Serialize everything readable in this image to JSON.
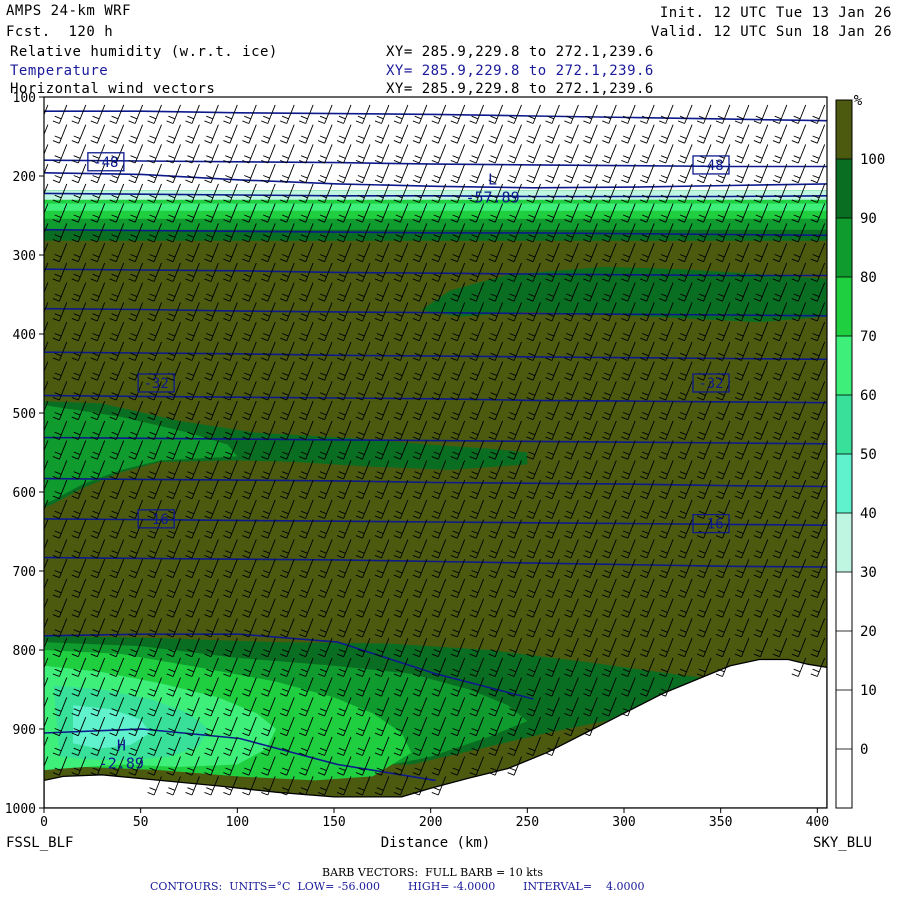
{
  "header": {
    "model": "AMPS 24-km WRF",
    "fcst": "Fcst.  120 h",
    "init": "Init. 12 UTC Tue 13 Jan 26",
    "valid": "Valid. 12 UTC Sun 18 Jan 26",
    "fields": [
      {
        "name": "Relative humidity (w.r.t. ice)",
        "xy": "XY= 285.9,229.8 to 272.1,239.6"
      },
      {
        "name": "Temperature",
        "xy": "XY= 285.9,229.8 to 272.1,239.6"
      },
      {
        "name": "Horizontal wind vectors",
        "xy": "XY= 285.9,229.8 to 272.1,239.6"
      }
    ]
  },
  "footer": {
    "barb": "BARB VECTORS:  FULL BARB = 10 kts",
    "contours": "CONTOURS:  UNITS=°C  LOW= -56.000        HIGH= -4.0000        INTERVAL=    4.0000"
  },
  "chart_data": {
    "type": "cross-section",
    "xlabel": "Distance (km)",
    "xlim": [
      0,
      405
    ],
    "ylim": [
      1000,
      100
    ],
    "x_ticks": [
      0,
      50,
      100,
      150,
      200,
      250,
      300,
      350,
      400
    ],
    "y_ticks": [
      100,
      200,
      300,
      400,
      500,
      600,
      700,
      800,
      900,
      1000
    ],
    "start_label": "FSSL_BLF",
    "end_label": "SKY_BLU",
    "colorbar": {
      "unit": "%",
      "levels": [
        0,
        10,
        20,
        30,
        40,
        50,
        60,
        70,
        80,
        90,
        100
      ],
      "colors": [
        "#ffffff",
        "#ffffff",
        "#ffffff",
        "#ffffff",
        "#bff6e2",
        "#5ff2cc",
        "#38e09a",
        "#3ef07a",
        "#1fcf40",
        "#0f9b2e",
        "#0a6e22",
        "#4c5a10"
      ]
    },
    "terrain_profile": [
      [
        0,
        1000
      ],
      [
        0,
        965
      ],
      [
        10,
        960
      ],
      [
        30,
        958
      ],
      [
        60,
        965
      ],
      [
        90,
        972
      ],
      [
        120,
        980
      ],
      [
        150,
        986
      ],
      [
        185,
        986
      ],
      [
        200,
        975
      ],
      [
        220,
        962
      ],
      [
        240,
        950
      ],
      [
        260,
        930
      ],
      [
        280,
        905
      ],
      [
        300,
        880
      ],
      [
        320,
        855
      ],
      [
        340,
        835
      ],
      [
        355,
        820
      ],
      [
        370,
        812
      ],
      [
        385,
        812
      ],
      [
        395,
        818
      ],
      [
        405,
        822
      ],
      [
        405,
        1000
      ]
    ],
    "rh_regions": [
      {
        "level": 100,
        "polygon": [
          [
            0,
            218
          ],
          [
            405,
            218
          ],
          [
            405,
            1000
          ],
          [
            0,
            1000
          ]
        ]
      },
      {
        "level": 90,
        "polygon": [
          [
            0,
            218
          ],
          [
            405,
            218
          ],
          [
            405,
            282
          ],
          [
            0,
            282
          ]
        ]
      },
      {
        "level": 90,
        "polygon": [
          [
            195,
            370
          ],
          [
            210,
            345
          ],
          [
            240,
            325
          ],
          [
            290,
            315
          ],
          [
            330,
            318
          ],
          [
            375,
            325
          ],
          [
            405,
            330
          ],
          [
            405,
            378
          ],
          [
            370,
            385
          ],
          [
            330,
            380
          ],
          [
            290,
            375
          ],
          [
            250,
            372
          ],
          [
            215,
            378
          ]
        ]
      },
      {
        "level": 80,
        "polygon": [
          [
            0,
            218
          ],
          [
            405,
            218
          ],
          [
            405,
            268
          ],
          [
            0,
            268
          ]
        ]
      },
      {
        "level": 90,
        "polygon": [
          [
            0,
            485
          ],
          [
            30,
            488
          ],
          [
            70,
            510
          ],
          [
            110,
            525
          ],
          [
            160,
            532
          ],
          [
            200,
            540
          ],
          [
            230,
            545
          ],
          [
            250,
            550
          ],
          [
            250,
            565
          ],
          [
            210,
            572
          ],
          [
            170,
            568
          ],
          [
            130,
            562
          ],
          [
            100,
            560
          ],
          [
            60,
            562
          ],
          [
            40,
            575
          ],
          [
            20,
            595
          ],
          [
            5,
            615
          ],
          [
            0,
            620
          ]
        ]
      },
      {
        "level": 80,
        "polygon": [
          [
            0,
            490
          ],
          [
            40,
            505
          ],
          [
            75,
            525
          ],
          [
            95,
            540
          ],
          [
            100,
            555
          ],
          [
            60,
            560
          ],
          [
            40,
            572
          ],
          [
            20,
            590
          ],
          [
            5,
            610
          ],
          [
            0,
            615
          ]
        ]
      },
      {
        "level": 70,
        "polygon": [
          [
            0,
            218
          ],
          [
            405,
            218
          ],
          [
            405,
            254
          ],
          [
            0,
            254
          ]
        ]
      },
      {
        "level": 90,
        "polygon": [
          [
            0,
            782
          ],
          [
            60,
            785
          ],
          [
            120,
            790
          ],
          [
            180,
            792
          ],
          [
            230,
            800
          ],
          [
            280,
            815
          ],
          [
            330,
            832
          ],
          [
            360,
            840
          ],
          [
            340,
            856
          ],
          [
            310,
            880
          ],
          [
            260,
            905
          ],
          [
            220,
            928
          ],
          [
            190,
            945
          ],
          [
            150,
            945
          ],
          [
            100,
            938
          ],
          [
            60,
            930
          ],
          [
            20,
            928
          ],
          [
            0,
            930
          ]
        ]
      },
      {
        "level": 80,
        "polygon": [
          [
            0,
            790
          ],
          [
            50,
            795
          ],
          [
            100,
            810
          ],
          [
            150,
            820
          ],
          [
            190,
            830
          ],
          [
            220,
            850
          ],
          [
            240,
            870
          ],
          [
            250,
            890
          ],
          [
            230,
            910
          ],
          [
            200,
            935
          ],
          [
            170,
            950
          ],
          [
            130,
            955
          ],
          [
            90,
            950
          ],
          [
            50,
            942
          ],
          [
            10,
            942
          ],
          [
            0,
            945
          ]
        ]
      },
      {
        "level": 70,
        "polygon": [
          [
            0,
            800
          ],
          [
            40,
            805
          ],
          [
            80,
            822
          ],
          [
            120,
            840
          ],
          [
            150,
            860
          ],
          [
            170,
            880
          ],
          [
            185,
            905
          ],
          [
            190,
            930
          ],
          [
            170,
            960
          ],
          [
            140,
            965
          ],
          [
            100,
            960
          ],
          [
            60,
            952
          ],
          [
            20,
            948
          ],
          [
            0,
            950
          ]
        ]
      },
      {
        "level": 60,
        "polygon": [
          [
            0,
            235
          ],
          [
            405,
            235
          ],
          [
            405,
            244
          ],
          [
            0,
            244
          ]
        ]
      },
      {
        "level": 60,
        "polygon": [
          [
            0,
            820
          ],
          [
            30,
            828
          ],
          [
            60,
            842
          ],
          [
            90,
            860
          ],
          [
            110,
            880
          ],
          [
            120,
            900
          ],
          [
            115,
            925
          ],
          [
            100,
            945
          ],
          [
            70,
            948
          ],
          [
            40,
            945
          ],
          [
            10,
            950
          ],
          [
            0,
            952
          ]
        ]
      },
      {
        "level": 50,
        "polygon": [
          [
            5,
            845
          ],
          [
            30,
            850
          ],
          [
            55,
            862
          ],
          [
            75,
            880
          ],
          [
            85,
            900
          ],
          [
            80,
            922
          ],
          [
            65,
            935
          ],
          [
            40,
            940
          ],
          [
            20,
            938
          ],
          [
            8,
            935
          ]
        ]
      },
      {
        "level": 40,
        "polygon": [
          [
            15,
            870
          ],
          [
            35,
            875
          ],
          [
            50,
            888
          ],
          [
            55,
            905
          ],
          [
            45,
            920
          ],
          [
            28,
            925
          ],
          [
            15,
            918
          ]
        ]
      },
      {
        "level": 30,
        "polygon": [
          [
            0,
            218
          ],
          [
            405,
            218
          ],
          [
            405,
            230
          ],
          [
            0,
            230
          ]
        ]
      },
      {
        "level": 10,
        "polygon": [
          [
            0,
            100
          ],
          [
            405,
            100
          ],
          [
            405,
            212
          ],
          [
            0,
            212
          ]
        ]
      }
    ],
    "temperature_contours": [
      {
        "label": "-52",
        "p": [
          118,
          118,
          120,
          121,
          122,
          124,
          126,
          128,
          130
        ]
      },
      {
        "label": "-48",
        "p": [
          180,
          181,
          182,
          183,
          185,
          186,
          187,
          188,
          188
        ]
      },
      {
        "label": "-52",
        "p": [
          196,
          198,
          205,
          210,
          213,
          215,
          214,
          212,
          210
        ]
      },
      {
        "label": "-56",
        "p": [
          222,
          223,
          224,
          225,
          225,
          226,
          226,
          226,
          225
        ]
      },
      {
        "label": "-44",
        "p": [
          268,
          269,
          270,
          271,
          272,
          272,
          273,
          274,
          275
        ]
      },
      {
        "label": "-40",
        "p": [
          318,
          319,
          320,
          322,
          323,
          324,
          325,
          326,
          326
        ]
      },
      {
        "label": "-36",
        "p": [
          368,
          369,
          371,
          372,
          373,
          374,
          375,
          376,
          377
        ]
      },
      {
        "label": "-32",
        "p": [
          423,
          424,
          425,
          427,
          428,
          429,
          430,
          431,
          432
        ]
      },
      {
        "label": "-28",
        "p": [
          478,
          479,
          480,
          481,
          482,
          484,
          485,
          486,
          487
        ]
      },
      {
        "label": "-24",
        "p": [
          531,
          532,
          533,
          534,
          535,
          536,
          537,
          538,
          539
        ]
      },
      {
        "label": "-20",
        "p": [
          583,
          584,
          585,
          586,
          588,
          589,
          590,
          592,
          593
        ]
      },
      {
        "label": "-16",
        "p": [
          634,
          635,
          636,
          637,
          638,
          639,
          640,
          641,
          642
        ]
      },
      {
        "label": "-12",
        "p": [
          683,
          684,
          685,
          686,
          688,
          690,
          692,
          694,
          695
        ]
      },
      {
        "label": "-8",
        "p": [
          782,
          780,
          780,
          790,
          830,
          862,
          null,
          null,
          null
        ]
      },
      {
        "label": "-4",
        "p": [
          905,
          900,
          912,
          945,
          965,
          null,
          null,
          null,
          null
        ]
      }
    ],
    "contour_labels": [
      {
        "text": "-48",
        "x": 32,
        "p": 182
      },
      {
        "text": "-48",
        "x": 345,
        "p": 186
      },
      {
        "text": "-32",
        "x": 58,
        "p": 462
      },
      {
        "text": "-32",
        "x": 345,
        "p": 462
      },
      {
        "text": "-16",
        "x": 58,
        "p": 634
      },
      {
        "text": "-16",
        "x": 345,
        "p": 640
      }
    ],
    "extrema": [
      {
        "kind": "L",
        "value": "-57.89",
        "x": 232,
        "p": 216
      },
      {
        "kind": "H",
        "value": "-2.89",
        "x": 40,
        "p": 932
      }
    ],
    "wind_barbs": {
      "u_kts": 8,
      "v_kts": 20
    }
  }
}
